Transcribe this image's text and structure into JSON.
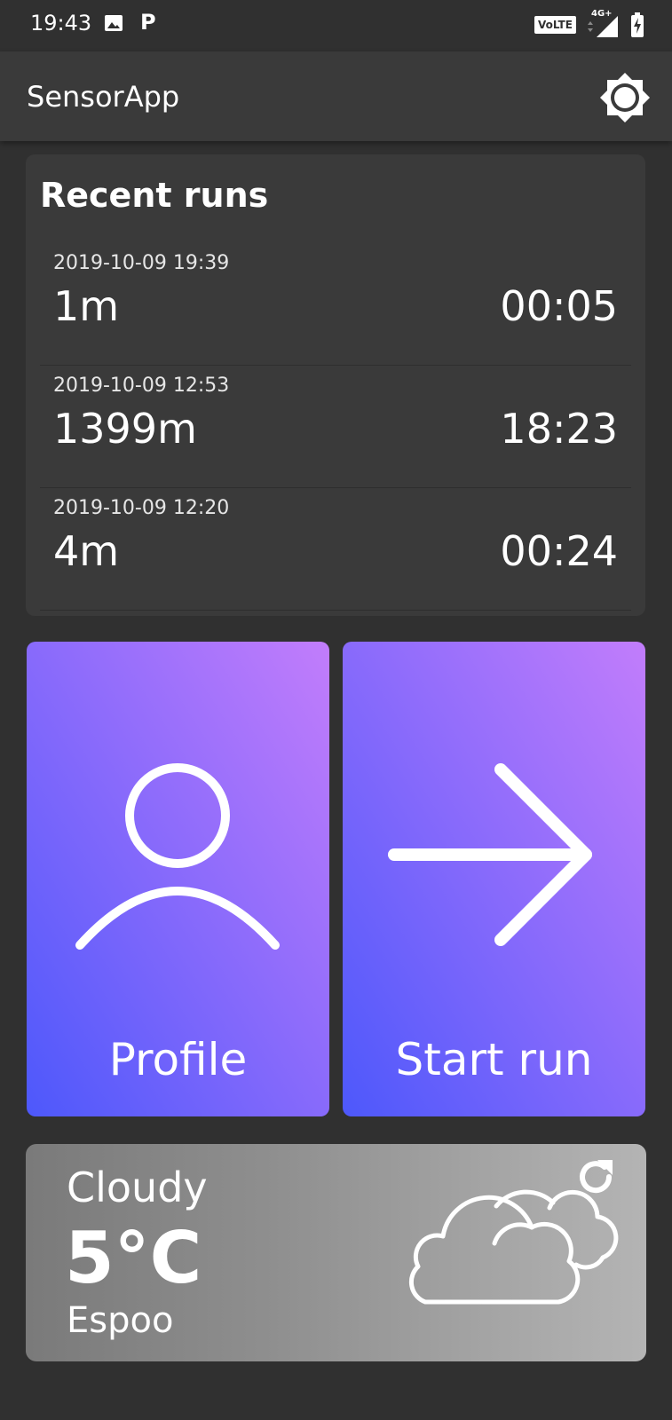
{
  "status_bar": {
    "time": "19:43",
    "p_glyph": "P",
    "volte": "VoLTE",
    "network": "4G+",
    "icons": [
      "gallery-icon",
      "signal-icon",
      "battery-charging-icon"
    ]
  },
  "app_bar": {
    "title": "SensorApp",
    "settings_icon": "brightness-gear-icon"
  },
  "recent_runs": {
    "title": "Recent runs",
    "items": [
      {
        "date": "2019-10-09 19:39",
        "distance": "1m",
        "duration": "00:05"
      },
      {
        "date": "2019-10-09 12:53",
        "distance": "1399m",
        "duration": "18:23"
      },
      {
        "date": "2019-10-09 12:20",
        "distance": "4m",
        "duration": "00:24"
      }
    ]
  },
  "actions": {
    "profile_label": "Profile",
    "profile_icon": "person-icon",
    "start_label": "Start run",
    "start_icon": "arrow-right-icon"
  },
  "weather": {
    "condition": "Cloudy",
    "temperature": "5°C",
    "city": "Espoo",
    "condition_icon": "cloud-icon",
    "refresh_icon": "refresh-icon"
  },
  "colors": {
    "background": "#303030",
    "card": "#3a3a3a",
    "gradient_top": "#c27dfb",
    "gradient_bottom": "#4d58fb"
  }
}
